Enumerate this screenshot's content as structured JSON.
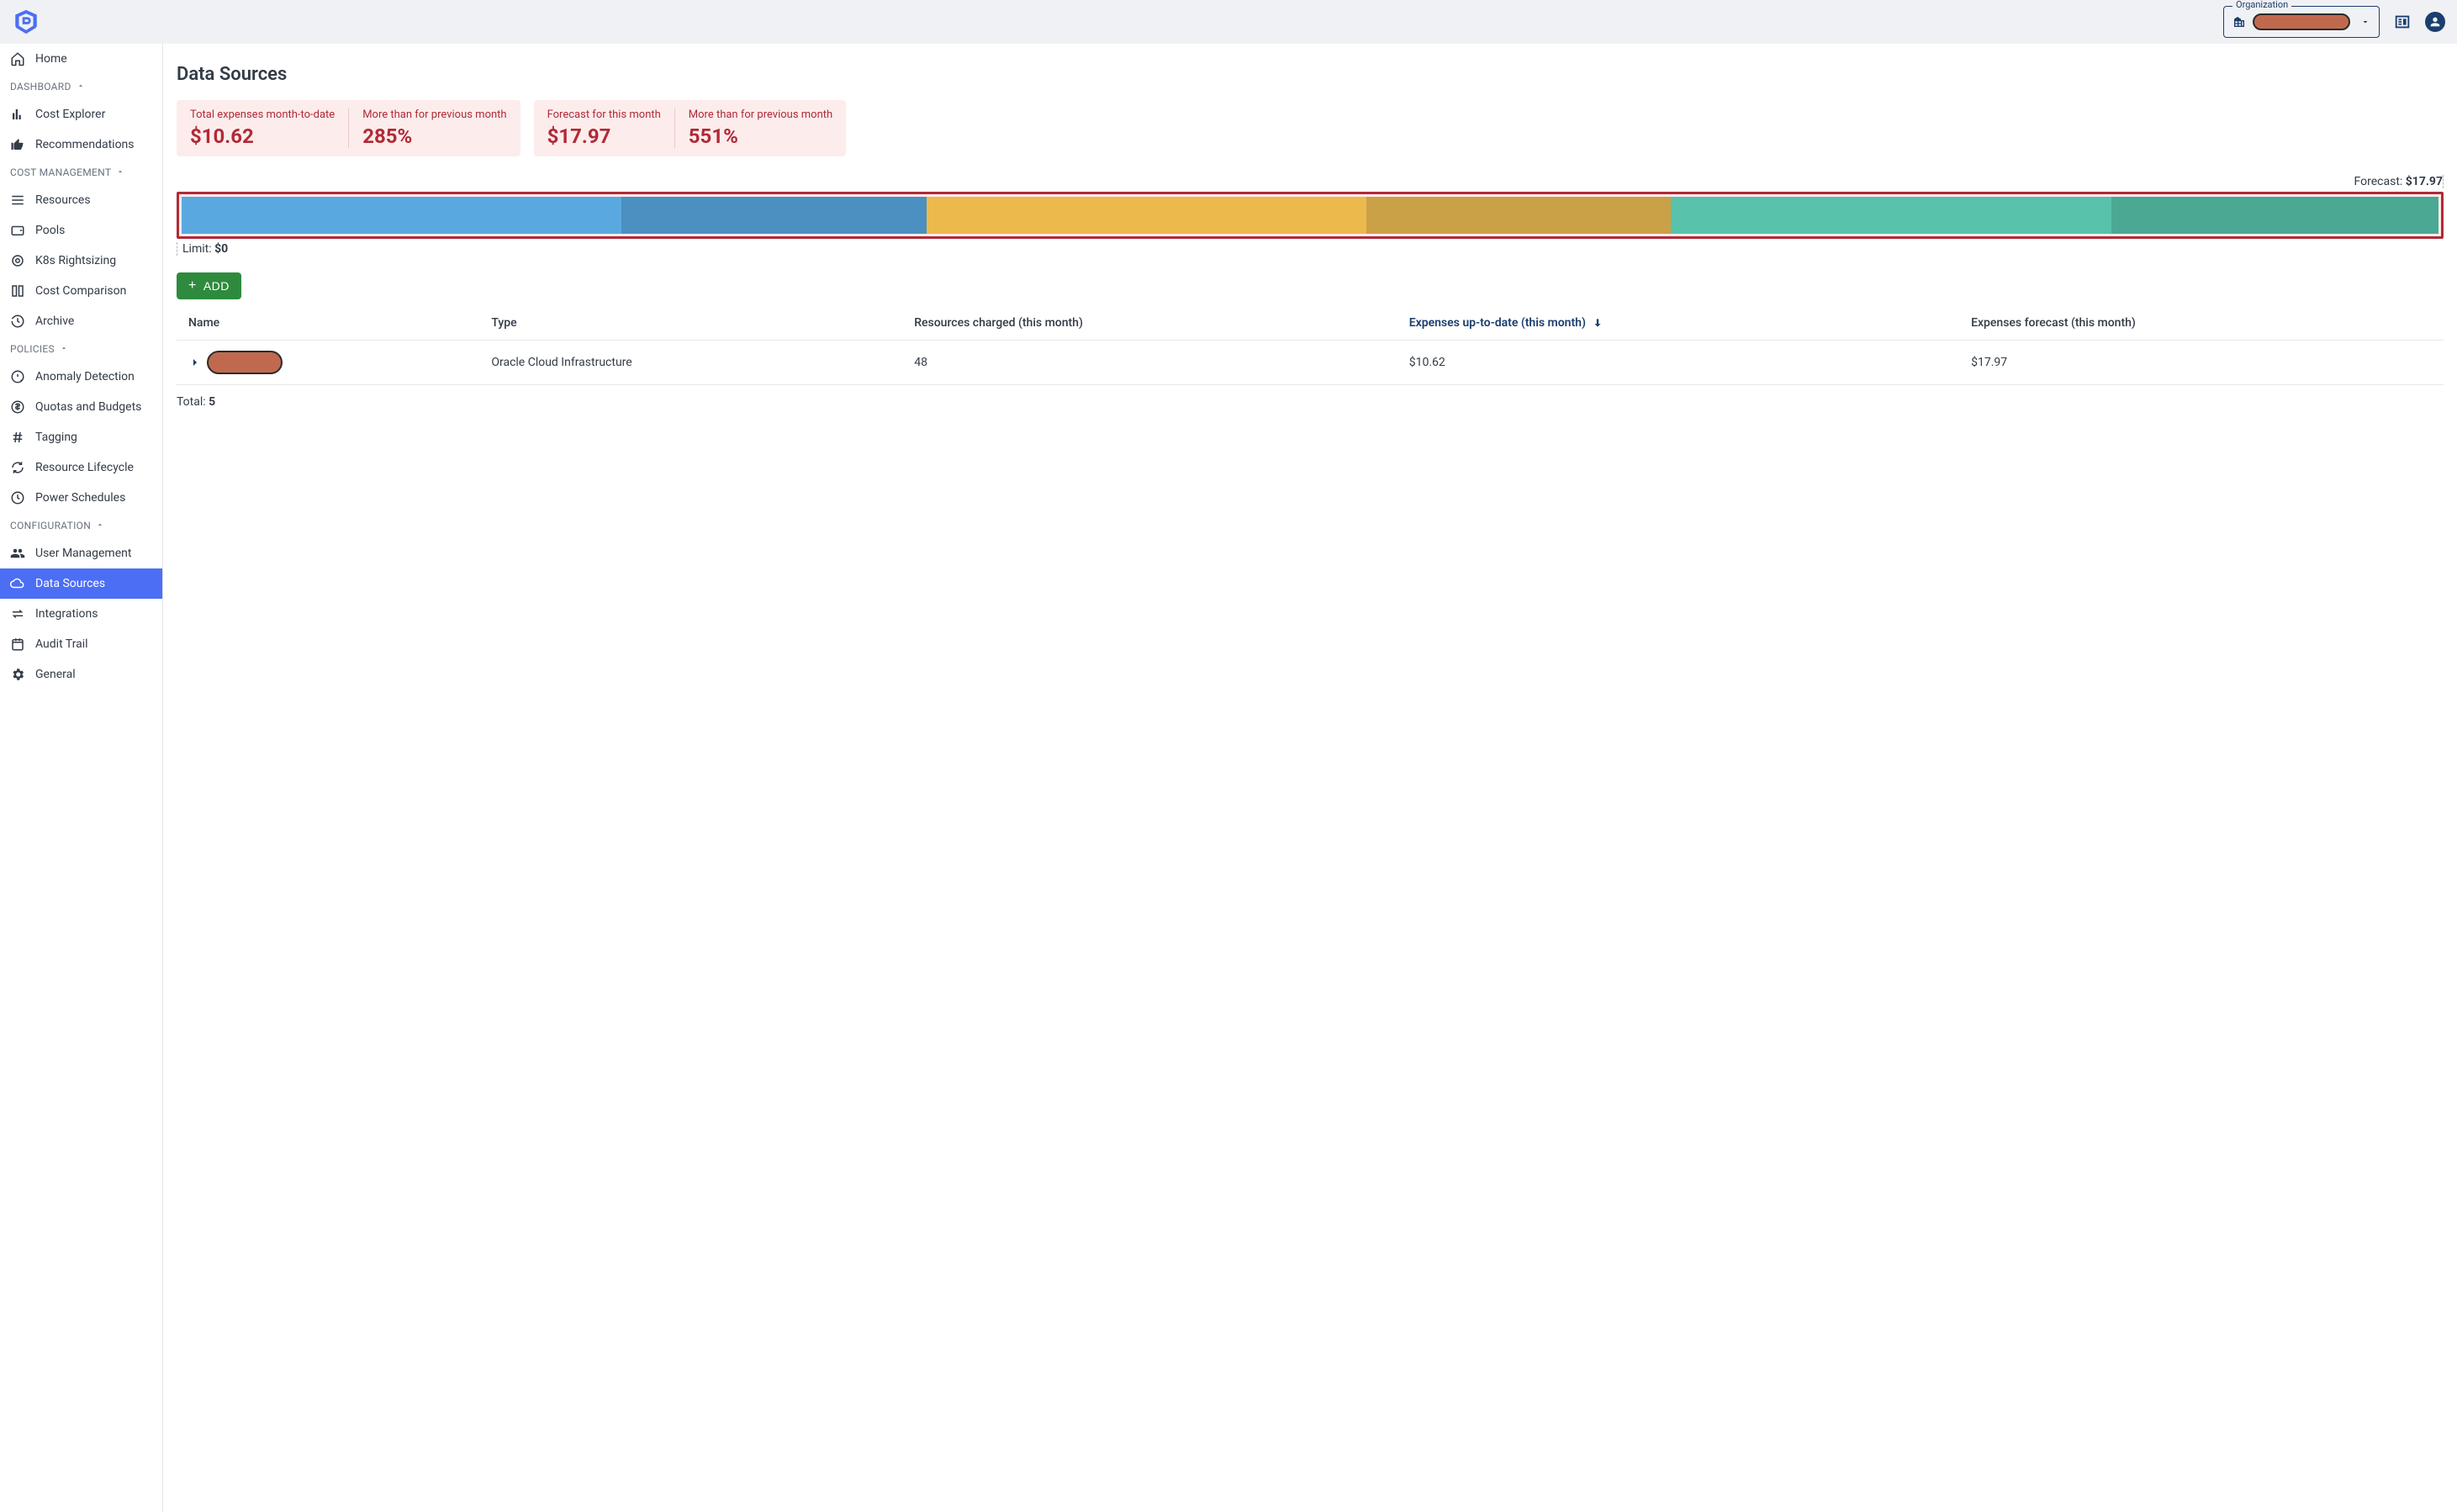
{
  "header": {
    "organization_label": "Organization"
  },
  "sidebar": {
    "home": "Home",
    "sections": {
      "dashboard": {
        "label": "DASHBOARD",
        "items": [
          {
            "label": "Cost Explorer"
          },
          {
            "label": "Recommendations"
          }
        ]
      },
      "cost_management": {
        "label": "COST MANAGEMENT",
        "items": [
          {
            "label": "Resources"
          },
          {
            "label": "Pools"
          },
          {
            "label": "K8s Rightsizing"
          },
          {
            "label": "Cost Comparison"
          },
          {
            "label": "Archive"
          }
        ]
      },
      "policies": {
        "label": "POLICIES",
        "items": [
          {
            "label": "Anomaly Detection"
          },
          {
            "label": "Quotas and Budgets"
          },
          {
            "label": "Tagging"
          },
          {
            "label": "Resource Lifecycle"
          },
          {
            "label": "Power Schedules"
          }
        ]
      },
      "configuration": {
        "label": "CONFIGURATION",
        "items": [
          {
            "label": "User Management"
          },
          {
            "label": "Data Sources"
          },
          {
            "label": "Integrations"
          },
          {
            "label": "Audit Trail"
          },
          {
            "label": "General"
          }
        ]
      }
    }
  },
  "page": {
    "title": "Data Sources",
    "summary": [
      {
        "cells": [
          {
            "label": "Total expenses month-to-date",
            "value": "$10.62"
          },
          {
            "label": "More than for previous month",
            "value": "285%"
          }
        ]
      },
      {
        "cells": [
          {
            "label": "Forecast for this month",
            "value": "$17.97"
          },
          {
            "label": "More than for previous month",
            "value": "551%"
          }
        ]
      }
    ],
    "forecast": {
      "top_label_prefix": "Forecast: ",
      "top_label_value": "$17.97",
      "bottom_label_prefix": "Limit: ",
      "bottom_label_value": "$0",
      "segments": [
        {
          "color": "#59a9e0",
          "width": 19.5
        },
        {
          "color": "#4c8fc1",
          "width": 13.5
        },
        {
          "color": "#ecb94c",
          "width": 19.5
        },
        {
          "color": "#caa147",
          "width": 13.5
        },
        {
          "color": "#58c2ab",
          "width": 19.5
        },
        {
          "color": "#4ba893",
          "width": 14.5
        }
      ]
    },
    "add_button": "ADD",
    "table": {
      "columns": {
        "name": "Name",
        "type": "Type",
        "resources": "Resources charged (this month)",
        "expenses": "Expenses up-to-date (this month)",
        "forecast": "Expenses forecast (this month)"
      },
      "rows": [
        {
          "type": "Oracle Cloud Infrastructure",
          "resources": "48",
          "expenses": "$10.62",
          "forecast": "$17.97"
        }
      ]
    },
    "total": {
      "prefix": "Total: ",
      "value": "5"
    }
  },
  "chart_data": {
    "type": "bar",
    "description": "Cumulative expense/forecast progress segments (approximate proportional widths)",
    "segments": [
      {
        "label": "seg1-actual",
        "color": "#59a9e0",
        "portion": 0.195
      },
      {
        "label": "seg1-forecast",
        "color": "#4c8fc1",
        "portion": 0.135
      },
      {
        "label": "seg2-actual",
        "color": "#ecb94c",
        "portion": 0.195
      },
      {
        "label": "seg2-forecast",
        "color": "#caa147",
        "portion": 0.135
      },
      {
        "label": "seg3-actual",
        "color": "#58c2ab",
        "portion": 0.195
      },
      {
        "label": "seg3-forecast",
        "color": "#4ba893",
        "portion": 0.145
      }
    ],
    "forecast_total": 17.97,
    "limit": 0,
    "expenses_to_date": 10.62
  }
}
